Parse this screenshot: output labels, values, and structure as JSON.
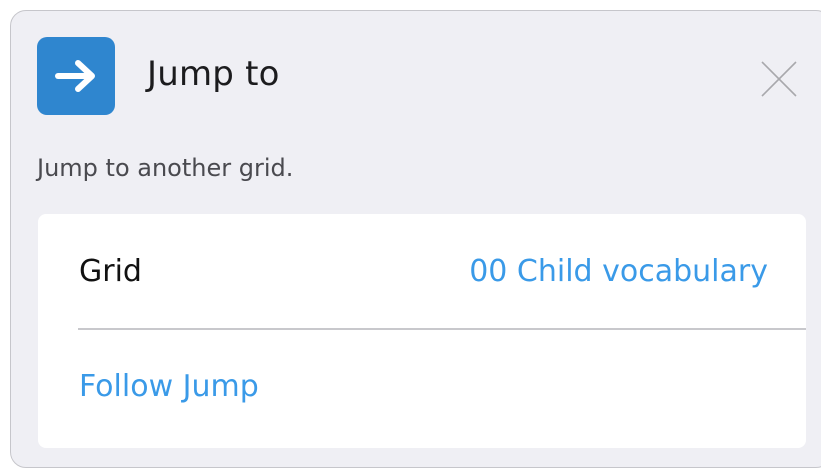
{
  "header": {
    "icon": "arrow-right-icon",
    "title": "Jump to",
    "close_icon": "close-icon"
  },
  "description": "Jump to another grid.",
  "settings": {
    "grid_label": "Grid",
    "grid_value": "00 Child vocabulary",
    "follow_label": "Follow Jump"
  },
  "colors": {
    "accent": "#2f86cf",
    "link": "#3a9ae8",
    "panel_background": "#efeff4",
    "card_background": "#ffffff"
  }
}
